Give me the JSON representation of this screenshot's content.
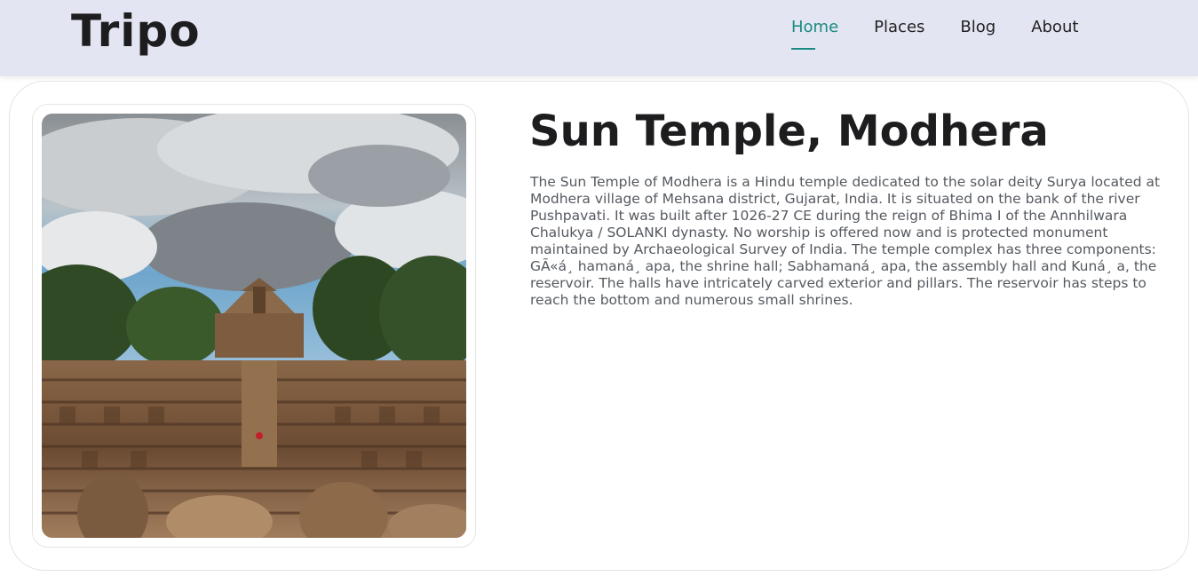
{
  "header": {
    "logo": "Tripo",
    "nav": [
      {
        "label": "Home",
        "active": true
      },
      {
        "label": "Places",
        "active": false
      },
      {
        "label": "Blog",
        "active": false
      },
      {
        "label": "About",
        "active": false
      }
    ],
    "accent_color": "#1a8a82",
    "background_color": "#e3e6f2"
  },
  "main": {
    "title": "Sun Temple, Modhera",
    "description": "The Sun Temple of Modhera is a Hindu temple dedicated to the solar deity Surya located at Modhera village of Mehsana district, Gujarat, India. It is situated on the bank of the river Pushpavati. It was built after 1026-27 CE during the reign of Bhima I of the Annhilwara Chalukya / SOLANKI dynasty. No worship is offered now and is protected monument maintained by Archaeological Survey of India. The temple complex has three components: GÃ«á¸ hamaná¸ apa, the shrine hall; Sabhamaná¸ apa, the assembly hall and Kuná¸ a, the reservoir. The halls have intricately carved exterior and pillars. The reservoir has steps to reach the bottom and numerous small shrines."
  }
}
